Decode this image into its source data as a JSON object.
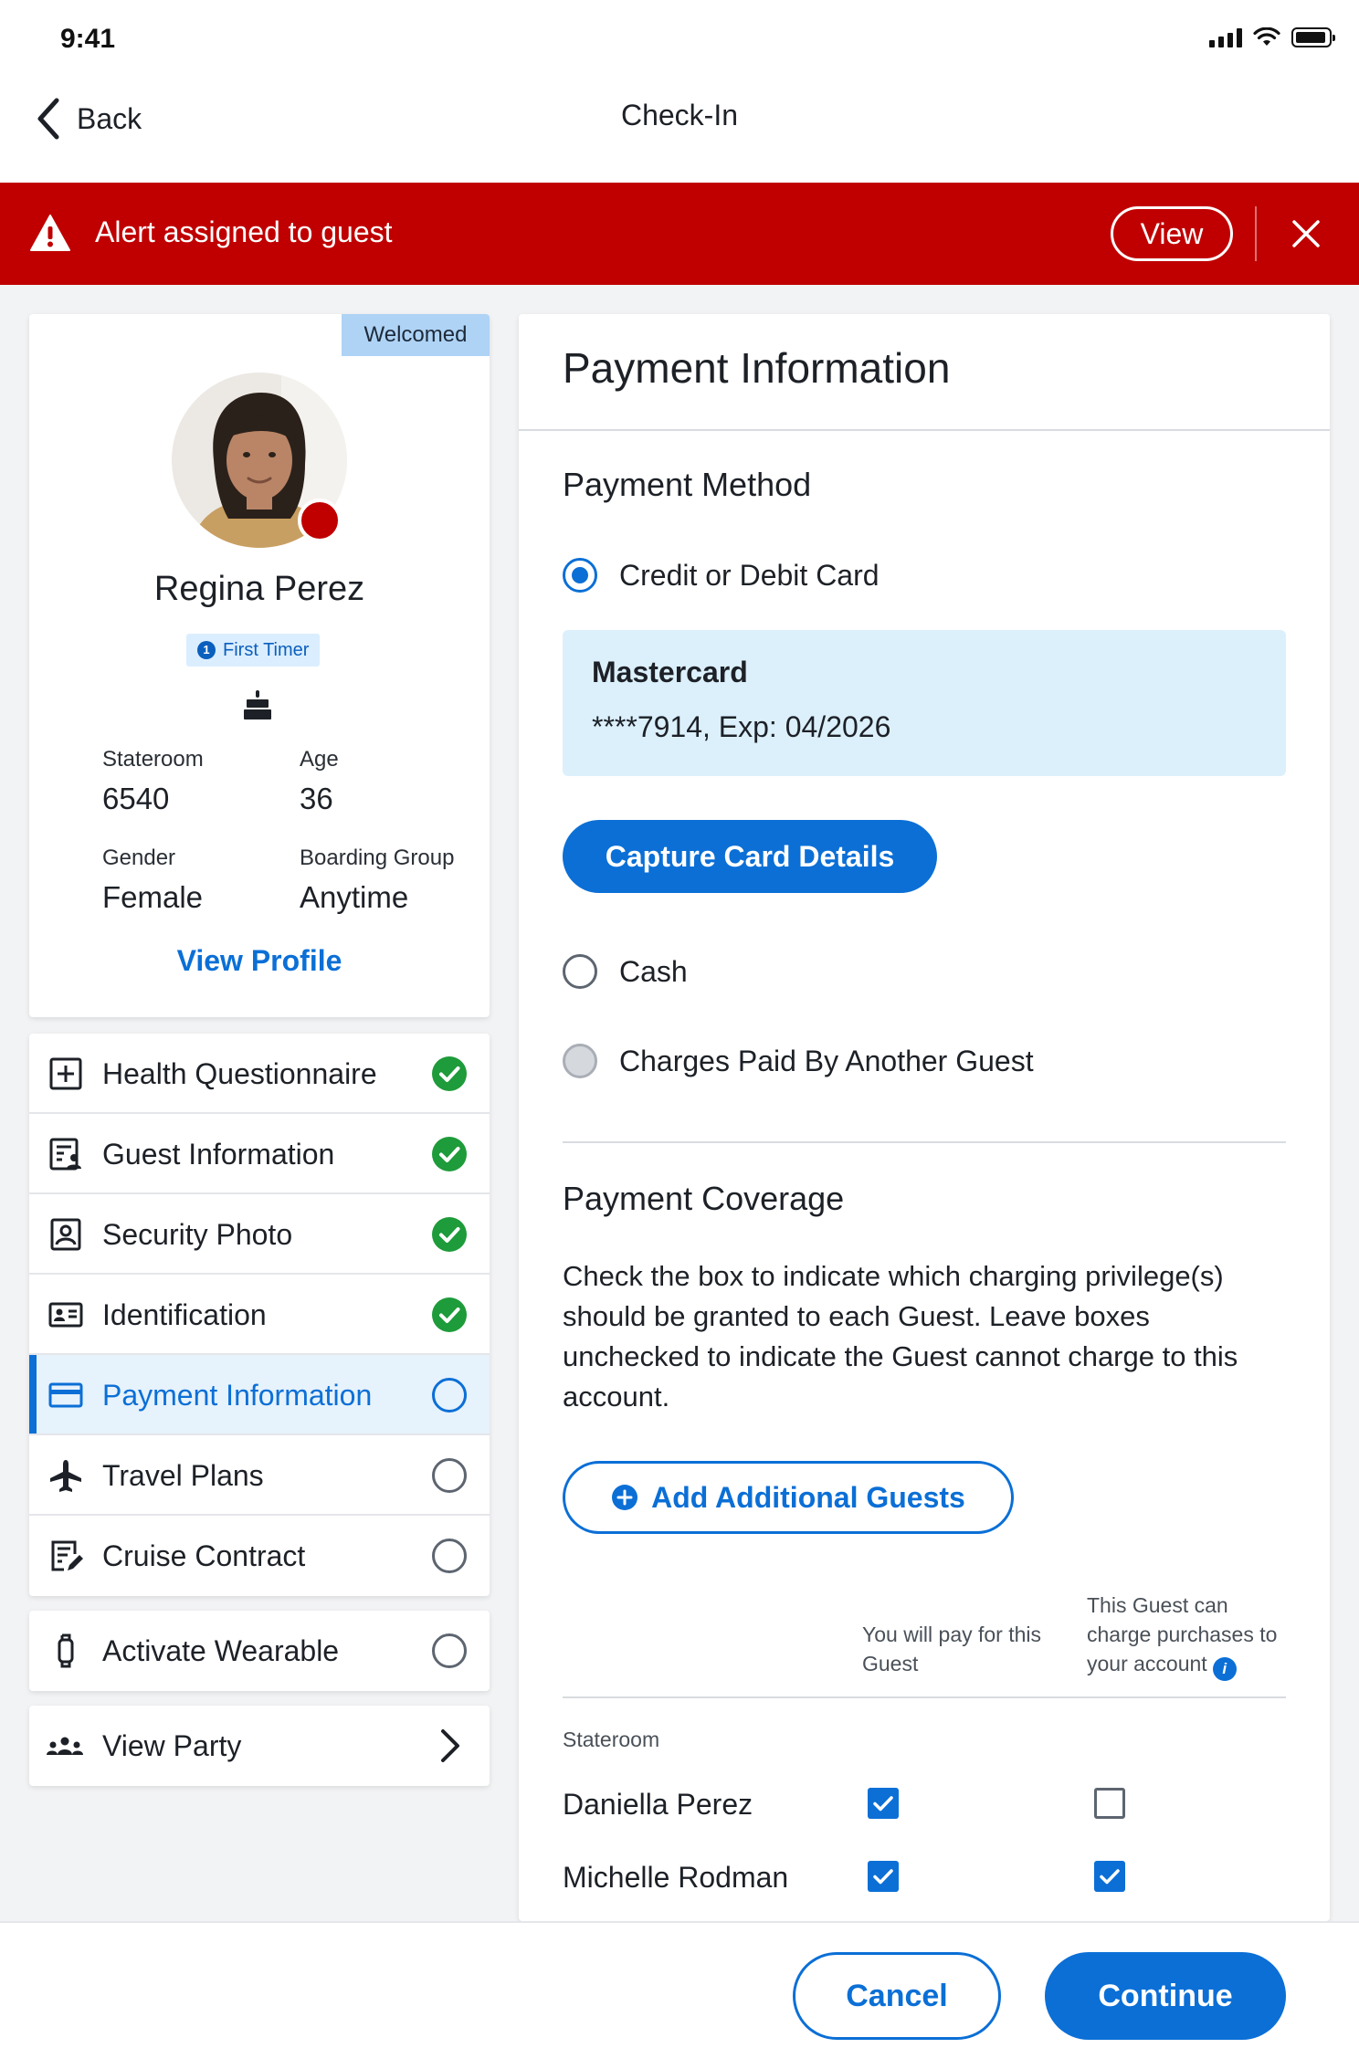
{
  "status_bar": {
    "time": "9:41"
  },
  "nav": {
    "back_label": "Back",
    "title": "Check-In"
  },
  "alert": {
    "message": "Alert assigned to guest",
    "view_label": "View",
    "color": "#c00000"
  },
  "profile": {
    "status_tag": "Welcomed",
    "name": "Regina Perez",
    "badge": "First Timer",
    "badge_icon": "1",
    "fields": {
      "stateroom_label": "Stateroom",
      "stateroom_value": "6540",
      "age_label": "Age",
      "age_value": "36",
      "gender_label": "Gender",
      "gender_value": "Female",
      "boarding_label": "Boarding Group",
      "boarding_value": "Anytime"
    },
    "view_profile_label": "View Profile"
  },
  "checklist": {
    "items": [
      {
        "label": "Health Questionnaire",
        "icon": "health-icon",
        "status": "complete"
      },
      {
        "label": "Guest Information",
        "icon": "guest-info-icon",
        "status": "complete"
      },
      {
        "label": "Security Photo",
        "icon": "security-photo-icon",
        "status": "complete"
      },
      {
        "label": "Identification",
        "icon": "id-card-icon",
        "status": "complete"
      },
      {
        "label": "Payment Information",
        "icon": "credit-card-icon",
        "status": "active"
      },
      {
        "label": "Travel Plans",
        "icon": "airplane-icon",
        "status": "incomplete"
      },
      {
        "label": "Cruise Contract",
        "icon": "contract-icon",
        "status": "incomplete"
      }
    ],
    "wearable_label": "Activate Wearable",
    "party_label": "View Party"
  },
  "payment": {
    "title": "Payment Information",
    "method_title": "Payment Method",
    "options": [
      {
        "label": "Credit or Debit Card",
        "state": "selected"
      },
      {
        "label": "Cash",
        "state": "unselected"
      },
      {
        "label": "Charges Paid By Another Guest",
        "state": "disabled"
      }
    ],
    "card": {
      "brand": "Mastercard",
      "details": "****7914, Exp: 04/2026"
    },
    "capture_label": "Capture Card Details",
    "coverage_title": "Payment Coverage",
    "coverage_desc": "Check the box to indicate which charging privilege(s) should be granted to each Guest. Leave boxes unchecked to indicate the Guest cannot charge to this account.",
    "add_guests_label": "Add Additional Guests",
    "col_pay_for": "You will pay for this Guest",
    "col_can_charge": "This Guest can charge purchases to your account",
    "group_label": "Stateroom",
    "guests": [
      {
        "name": "Daniella Perez",
        "pay_for": true,
        "can_charge": false
      },
      {
        "name": "Michelle Rodman",
        "pay_for": true,
        "can_charge": true
      }
    ]
  },
  "footer": {
    "cancel_label": "Cancel",
    "continue_label": "Continue"
  },
  "colors": {
    "accent": "#0b6fd6",
    "success": "#1e9b3a",
    "alert": "#c00000",
    "card_bg": "#dcf0fc"
  }
}
